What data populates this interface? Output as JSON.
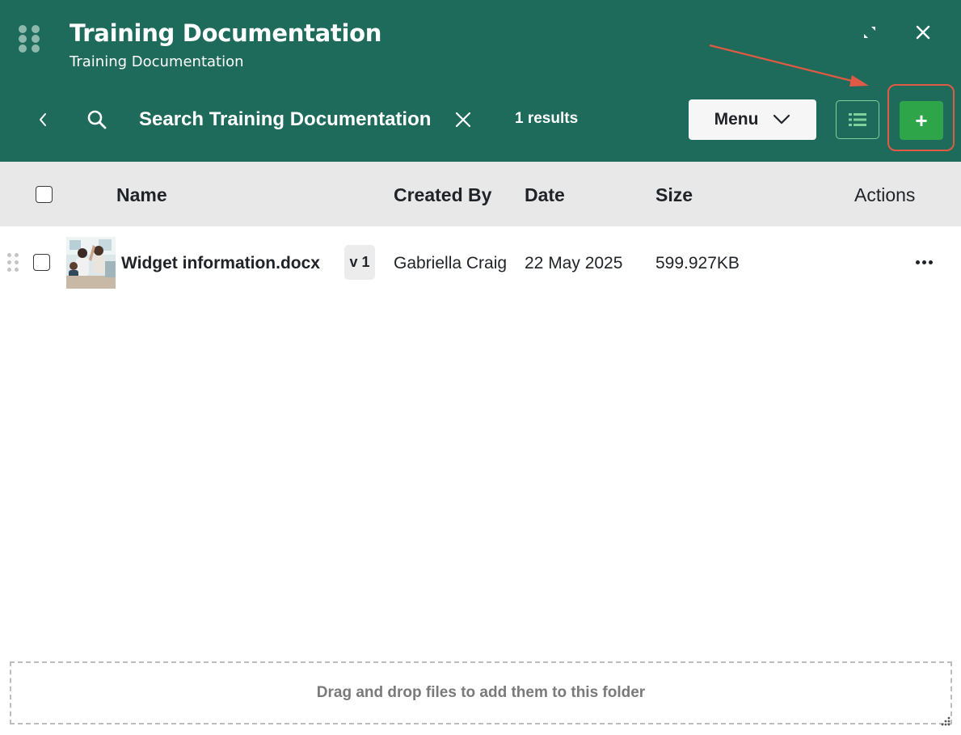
{
  "header": {
    "title": "Training Documentation",
    "subtitle": "Training Documentation",
    "color": "#1e6b5c"
  },
  "toolbar": {
    "search_placeholder": "Search Training Documentation",
    "search_value": "",
    "results_text": "1 results",
    "menu_label": "Menu",
    "add_label": "+",
    "add_color": "#2fa54a"
  },
  "icons": {
    "drag": "drag-grip-icon",
    "expand": "expand-icon",
    "close": "close-icon",
    "back": "chevron-left-icon",
    "search": "search-icon",
    "clear": "close-icon",
    "menu": "chevron-down-icon",
    "list_view": "list-icon",
    "more": "more-horizontal-icon"
  },
  "table": {
    "columns": [
      "Name",
      "Created By",
      "Date",
      "Size",
      "Actions"
    ],
    "rows": [
      {
        "name": "Widget information.docx",
        "version": "v 1",
        "created_by": "Gabriella Craig",
        "date": "22 May 2025",
        "size": "599.927KB"
      }
    ]
  },
  "dropzone": {
    "text": "Drag and drop files to add them to this folder"
  },
  "annotation": {
    "highlight_color": "#e25a45"
  }
}
